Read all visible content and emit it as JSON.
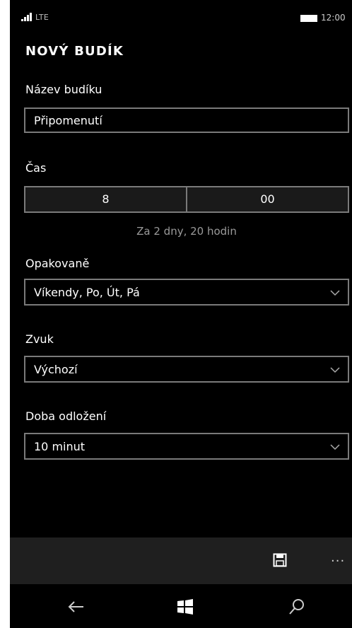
{
  "status": {
    "network": "LTE",
    "time": "12:00"
  },
  "page": {
    "title": "NOVÝ BUDÍK"
  },
  "name_field": {
    "label": "Název budíku",
    "value": "Připomenutí"
  },
  "time_field": {
    "label": "Čas",
    "hour": "8",
    "minute": "00",
    "hint": "Za 2 dny, 20 hodin"
  },
  "repeat_field": {
    "label": "Opakovaně",
    "value": "Víkendy, Po, Út, Pá"
  },
  "sound_field": {
    "label": "Zvuk",
    "value": "Výchozí"
  },
  "snooze_field": {
    "label": "Doba odložení",
    "value": "10 minut"
  },
  "appbar": {
    "more": "..."
  },
  "colors": {
    "background": "#000000",
    "appbar": "#1f1f1f",
    "border": "#7a7a7a",
    "hint": "#9a9a9a"
  },
  "icons": [
    "signal-icon",
    "battery-icon",
    "save-icon",
    "more-icon",
    "back-icon",
    "windows-icon",
    "search-icon",
    "chevron-down-icon"
  ]
}
